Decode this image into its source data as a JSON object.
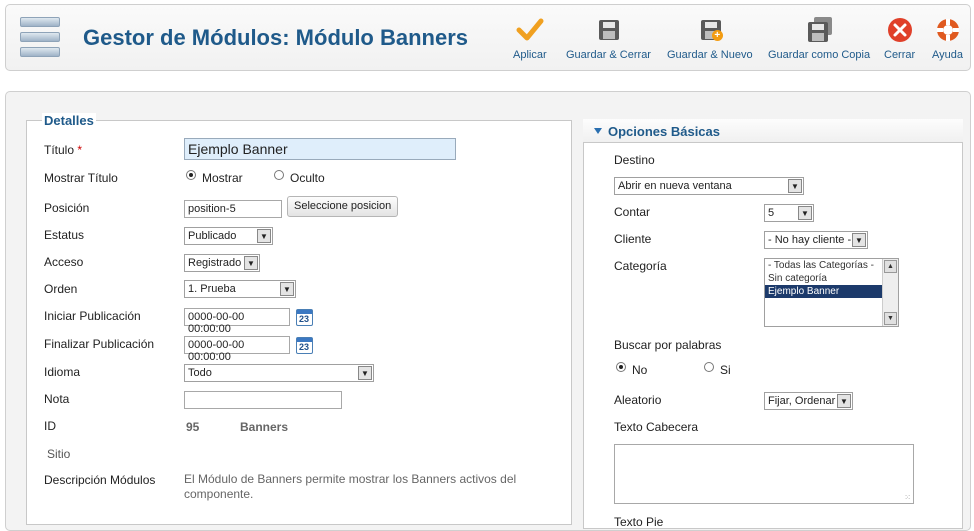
{
  "header": {
    "title": "Gestor de Módulos: Módulo Banners",
    "buttons": [
      {
        "label": "Aplicar",
        "icon": "check-icon"
      },
      {
        "label": "Guardar & Cerrar",
        "icon": "save-icon"
      },
      {
        "label": "Guardar & Nuevo",
        "icon": "save-new-icon"
      },
      {
        "label": "Guardar como Copia",
        "icon": "save-copy-icon"
      },
      {
        "label": "Cerrar",
        "icon": "close-icon"
      },
      {
        "label": "Ayuda",
        "icon": "help-lifebuoy-icon"
      }
    ]
  },
  "details": {
    "legend": "Detalles",
    "titulo_label": "Título",
    "required_mark": "*",
    "titulo_value": "Ejemplo Banner",
    "mostrar_titulo_label": "Mostrar Título",
    "mostrar_option": "Mostrar",
    "oculto_option": "Oculto",
    "posicion_label": "Posición",
    "posicion_value": "position-5",
    "posicion_button": "Seleccione posicion",
    "estatus_label": "Estatus",
    "estatus_value": "Publicado",
    "acceso_label": "Acceso",
    "acceso_value": "Registrado",
    "orden_label": "Orden",
    "orden_value": "1. Prueba",
    "iniciar_label": "Iniciar Publicación",
    "iniciar_value": "0000-00-00 00:00:00",
    "finalizar_label": "Finalizar Publicación",
    "finalizar_value": "0000-00-00 00:00:00",
    "calendar_day": "23",
    "idioma_label": "Idioma",
    "idioma_value": "Todo",
    "nota_label": "Nota",
    "nota_value": "",
    "id_label": "ID",
    "id_value": "95",
    "id_type": "Banners",
    "sitio_label": "Sitio",
    "descripcion_label": "Descripción Módulos",
    "descripcion_value": "El Módulo de Banners permite mostrar los Banners activos del componente."
  },
  "options": {
    "title": "Opciones Básicas",
    "destino_label": "Destino",
    "destino_value": "Abrir en nueva ventana",
    "contar_label": "Contar",
    "contar_value": "5",
    "cliente_label": "Cliente",
    "cliente_value": "- No hay cliente -",
    "categoria_label": "Categoría",
    "categoria_options": [
      "- Todas las Categorías -",
      "Sin categoría",
      "Ejemplo Banner"
    ],
    "buscar_label": "Buscar por palabras",
    "no_option": "No",
    "si_option": "Si",
    "aleatorio_label": "Aleatorio",
    "aleatorio_value": "Fijar, Ordenar",
    "texto_cabecera_label": "Texto Cabecera",
    "texto_pie_label": "Texto Pie"
  },
  "colors": {
    "title_blue": "#1f5a8a",
    "apply_orange": "#f0a020",
    "close_red": "#e0402a",
    "selected_option": "#1c3a6b"
  }
}
